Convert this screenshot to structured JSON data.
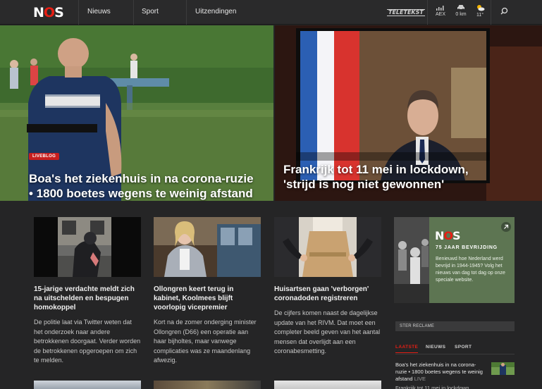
{
  "header": {
    "logo_text": "NOS",
    "nav": [
      "Nieuws",
      "Sport",
      "Uitzendingen"
    ],
    "teletekst": "TELETEKST",
    "widgets": {
      "aex": "AEX",
      "traffic": "0 km",
      "weather": "11°"
    }
  },
  "hero": {
    "left": {
      "badge": "LIVEBLOG",
      "title": "Boa's het ziekenhuis in na corona-ruzie • 1800 boetes wegens te weinig afstand"
    },
    "right": {
      "title": "Frankrijk tot 11 mei in lockdown, 'strijd is nog niet gewonnen'"
    }
  },
  "articles": [
    {
      "title": "15-jarige verdachte meldt zich na uitschelden en bespugen homokoppel",
      "summary": "De politie laat via Twitter weten dat het onderzoek naar andere betrokkenen doorgaat. Verder worden de betrokkenen opgeroepen om zich te melden."
    },
    {
      "title": "Ollongren keert terug in kabinet, Koolmees blijft voorlopig vicepremier",
      "summary": "Kort na de zomer onderging minister Ollongren (D66) een operatie aan haar bijholtes, maar vanwege complicaties was ze maandenlang afwezig."
    },
    {
      "title": "Huisartsen gaan 'verborgen' coronadoden registreren",
      "summary": "De cijfers komen naast de dagelijkse update van het RIVM. Dat moet een completer beeld geven van het aantal mensen dat overlijdt aan een coronabesmetting."
    }
  ],
  "promo": {
    "logo": "NOS",
    "subtitle": "75 JAAR BEVRIJDING",
    "text": "Benieuwd hoe Nederland werd bevrijd in 1944-1945? Volg het nieuws van dag tot dag op onze speciale website."
  },
  "sidebar": {
    "ster": "STER RECLAME",
    "tabs": [
      "LAATSTE",
      "NIEUWS",
      "SPORT"
    ],
    "latest_item": "Boa's het ziekenhuis in na corona-ruzie • 1800 boetes wegens te weinig afstand",
    "latest_live": "LIVE",
    "latest_item_2": "Frankrijk tot 11 mei in lockdown,"
  },
  "colors": {
    "accent": "#e61e14",
    "background": "#252526",
    "topbar": "#2a2a2b",
    "promo": "#5d7552"
  }
}
